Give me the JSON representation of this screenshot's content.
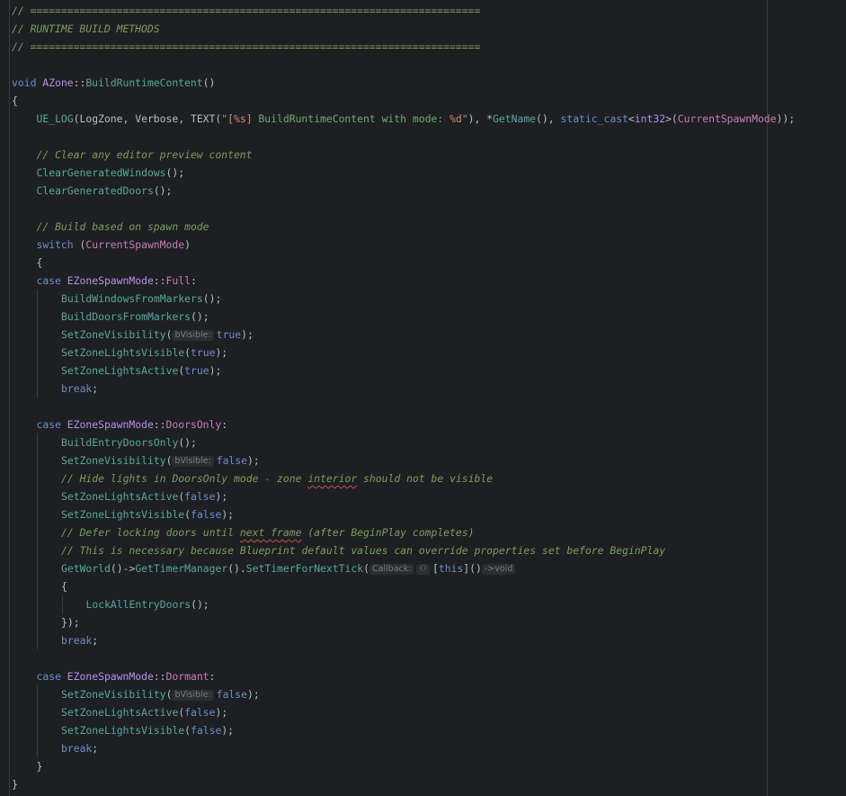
{
  "editor": {
    "language": "cpp",
    "theme_colors": {
      "background": "#1e1f22",
      "comment": "#7a9e5d",
      "keyword": "#6b8ec9",
      "type": "#b392f0",
      "function": "#56a8a0",
      "string": "#6aab73",
      "plain": "#bcbec4"
    },
    "lines": [
      {
        "indent": 0,
        "tokens": [
          {
            "t": "// =========================================================================",
            "c": "cm"
          }
        ]
      },
      {
        "indent": 0,
        "tokens": [
          {
            "t": "// RUNTIME BUILD METHODS",
            "c": "cm"
          }
        ]
      },
      {
        "indent": 0,
        "tokens": [
          {
            "t": "// =========================================================================",
            "c": "cm"
          }
        ]
      },
      {
        "indent": 0,
        "tokens": []
      },
      {
        "indent": 0,
        "tokens": [
          {
            "t": "void",
            "c": "kw"
          },
          {
            "t": " ",
            "c": "pl"
          },
          {
            "t": "AZone",
            "c": "ty"
          },
          {
            "t": "::",
            "c": "pl"
          },
          {
            "t": "BuildRuntimeContent",
            "c": "fn"
          },
          {
            "t": "()",
            "c": "pl"
          }
        ]
      },
      {
        "indent": 0,
        "tokens": [
          {
            "t": "{",
            "c": "pl"
          }
        ]
      },
      {
        "indent": 1,
        "tokens": [
          {
            "t": "UE_LOG",
            "c": "mac"
          },
          {
            "t": "(LogZone, ",
            "c": "pl"
          },
          {
            "t": "Verbose",
            "c": "pl"
          },
          {
            "t": ", ",
            "c": "pl"
          },
          {
            "t": "TEXT",
            "c": "pl"
          },
          {
            "t": "(",
            "c": "pl"
          },
          {
            "t": "\"",
            "c": "str"
          },
          {
            "t": "[%s]",
            "c": "esc"
          },
          {
            "t": " BuildRuntimeContent with mode: ",
            "c": "str"
          },
          {
            "t": "%d",
            "c": "esc"
          },
          {
            "t": "\"",
            "c": "str"
          },
          {
            "t": "), *",
            "c": "pl"
          },
          {
            "t": "GetName",
            "c": "fn"
          },
          {
            "t": "(), ",
            "c": "pl"
          },
          {
            "t": "static_cast",
            "c": "kw"
          },
          {
            "t": "<",
            "c": "pl"
          },
          {
            "t": "int32",
            "c": "ty"
          },
          {
            "t": ">(",
            "c": "pl"
          },
          {
            "t": "CurrentSpawnMode",
            "c": "cl"
          },
          {
            "t": "));",
            "c": "pl"
          }
        ]
      },
      {
        "indent": 0,
        "tokens": []
      },
      {
        "indent": 1,
        "tokens": [
          {
            "t": "// Clear any editor preview content",
            "c": "cm"
          }
        ]
      },
      {
        "indent": 1,
        "tokens": [
          {
            "t": "ClearGeneratedWindows",
            "c": "fn"
          },
          {
            "t": "();",
            "c": "pl"
          }
        ]
      },
      {
        "indent": 1,
        "tokens": [
          {
            "t": "ClearGeneratedDoors",
            "c": "fn"
          },
          {
            "t": "();",
            "c": "pl"
          }
        ]
      },
      {
        "indent": 0,
        "tokens": []
      },
      {
        "indent": 1,
        "tokens": [
          {
            "t": "// Build based on spawn mode",
            "c": "cm"
          }
        ]
      },
      {
        "indent": 1,
        "tokens": [
          {
            "t": "switch",
            "c": "kw"
          },
          {
            "t": " (",
            "c": "pl"
          },
          {
            "t": "CurrentSpawnMode",
            "c": "cl"
          },
          {
            "t": ")",
            "c": "pl"
          }
        ]
      },
      {
        "indent": 1,
        "tokens": [
          {
            "t": "{",
            "c": "pl"
          }
        ]
      },
      {
        "indent": 1,
        "tokens": [
          {
            "t": "case",
            "c": "kw"
          },
          {
            "t": " ",
            "c": "pl"
          },
          {
            "t": "EZoneSpawnMode",
            "c": "ty"
          },
          {
            "t": "::",
            "c": "pl"
          },
          {
            "t": "Full",
            "c": "cl"
          },
          {
            "t": ":",
            "c": "pl"
          }
        ]
      },
      {
        "indent": 2,
        "tokens": [
          {
            "t": "BuildWindowsFromMarkers",
            "c": "fn"
          },
          {
            "t": "();",
            "c": "pl"
          }
        ]
      },
      {
        "indent": 2,
        "tokens": [
          {
            "t": "BuildDoorsFromMarkers",
            "c": "fn"
          },
          {
            "t": "();",
            "c": "pl"
          }
        ]
      },
      {
        "indent": 2,
        "tokens": [
          {
            "t": "SetZoneVisibility",
            "c": "fn"
          },
          {
            "t": "(",
            "c": "pl"
          },
          {
            "t": "bVisible:",
            "c": "hint"
          },
          {
            "t": "true",
            "c": "kw"
          },
          {
            "t": ");",
            "c": "pl"
          }
        ]
      },
      {
        "indent": 2,
        "tokens": [
          {
            "t": "SetZoneLightsVisible",
            "c": "fn"
          },
          {
            "t": "(",
            "c": "pl"
          },
          {
            "t": "true",
            "c": "kw"
          },
          {
            "t": ");",
            "c": "pl"
          }
        ]
      },
      {
        "indent": 2,
        "tokens": [
          {
            "t": "SetZoneLightsActive",
            "c": "fn"
          },
          {
            "t": "(",
            "c": "pl"
          },
          {
            "t": "true",
            "c": "kw"
          },
          {
            "t": ");",
            "c": "pl"
          }
        ]
      },
      {
        "indent": 2,
        "tokens": [
          {
            "t": "break",
            "c": "kw"
          },
          {
            "t": ";",
            "c": "pl"
          }
        ]
      },
      {
        "indent": 0,
        "tokens": []
      },
      {
        "indent": 1,
        "tokens": [
          {
            "t": "case",
            "c": "kw"
          },
          {
            "t": " ",
            "c": "pl"
          },
          {
            "t": "EZoneSpawnMode",
            "c": "ty"
          },
          {
            "t": "::",
            "c": "pl"
          },
          {
            "t": "DoorsOnly",
            "c": "cl"
          },
          {
            "t": ":",
            "c": "pl"
          }
        ]
      },
      {
        "indent": 2,
        "tokens": [
          {
            "t": "BuildEntryDoorsOnly",
            "c": "fn"
          },
          {
            "t": "();",
            "c": "pl"
          }
        ]
      },
      {
        "indent": 2,
        "tokens": [
          {
            "t": "SetZoneVisibility",
            "c": "fn"
          },
          {
            "t": "(",
            "c": "pl"
          },
          {
            "t": "bVisible:",
            "c": "hint"
          },
          {
            "t": "false",
            "c": "kw"
          },
          {
            "t": ");",
            "c": "pl"
          }
        ]
      },
      {
        "indent": 2,
        "tokens": [
          {
            "t": "// Hide lights in DoorsOnly mode - zone ",
            "c": "cm"
          },
          {
            "t": "interior",
            "c": "cm squig"
          },
          {
            "t": " should not be visible",
            "c": "cm"
          }
        ]
      },
      {
        "indent": 2,
        "tokens": [
          {
            "t": "SetZoneLightsActive",
            "c": "fn"
          },
          {
            "t": "(",
            "c": "pl"
          },
          {
            "t": "false",
            "c": "kw"
          },
          {
            "t": ");",
            "c": "pl"
          }
        ]
      },
      {
        "indent": 2,
        "tokens": [
          {
            "t": "SetZoneLightsVisible",
            "c": "fn"
          },
          {
            "t": "(",
            "c": "pl"
          },
          {
            "t": "false",
            "c": "kw"
          },
          {
            "t": ");",
            "c": "pl"
          }
        ]
      },
      {
        "indent": 2,
        "tokens": [
          {
            "t": "// Defer locking doors until ",
            "c": "cm"
          },
          {
            "t": "next frame",
            "c": "cm squig"
          },
          {
            "t": " (after BeginPlay completes)",
            "c": "cm"
          }
        ]
      },
      {
        "indent": 2,
        "tokens": [
          {
            "t": "// This is necessary because Blueprint default values can override properties set before BeginPlay",
            "c": "cm"
          }
        ]
      },
      {
        "indent": 2,
        "tokens": [
          {
            "t": "GetWorld",
            "c": "fn"
          },
          {
            "t": "()->",
            "c": "pl"
          },
          {
            "t": "GetTimerManager",
            "c": "fn"
          },
          {
            "t": "().",
            "c": "pl"
          },
          {
            "t": "SetTimerForNextTick",
            "c": "fn"
          },
          {
            "t": "(",
            "c": "pl"
          },
          {
            "t": "Callback:",
            "c": "hint"
          },
          {
            "t": "⚇",
            "c": "hint"
          },
          {
            "t": "[",
            "c": "pl"
          },
          {
            "t": "this",
            "c": "kw"
          },
          {
            "t": "]",
            "c": "pl"
          },
          {
            "t": "()",
            "c": "pl"
          },
          {
            "t": "->void",
            "c": "hint"
          }
        ]
      },
      {
        "indent": 2,
        "tokens": [
          {
            "t": "{",
            "c": "pl"
          }
        ]
      },
      {
        "indent": 3,
        "tokens": [
          {
            "t": "LockAllEntryDoors",
            "c": "fn"
          },
          {
            "t": "();",
            "c": "pl"
          }
        ]
      },
      {
        "indent": 2,
        "tokens": [
          {
            "t": "});",
            "c": "pl"
          }
        ]
      },
      {
        "indent": 2,
        "tokens": [
          {
            "t": "break",
            "c": "kw"
          },
          {
            "t": ";",
            "c": "pl"
          }
        ]
      },
      {
        "indent": 0,
        "tokens": []
      },
      {
        "indent": 1,
        "tokens": [
          {
            "t": "case",
            "c": "kw"
          },
          {
            "t": " ",
            "c": "pl"
          },
          {
            "t": "EZoneSpawnMode",
            "c": "ty"
          },
          {
            "t": "::",
            "c": "pl"
          },
          {
            "t": "Dormant",
            "c": "cl"
          },
          {
            "t": ":",
            "c": "pl"
          }
        ]
      },
      {
        "indent": 2,
        "tokens": [
          {
            "t": "SetZoneVisibility",
            "c": "fn"
          },
          {
            "t": "(",
            "c": "pl"
          },
          {
            "t": "bVisible:",
            "c": "hint"
          },
          {
            "t": "false",
            "c": "kw"
          },
          {
            "t": ");",
            "c": "pl"
          }
        ]
      },
      {
        "indent": 2,
        "tokens": [
          {
            "t": "SetZoneLightsActive",
            "c": "fn"
          },
          {
            "t": "(",
            "c": "pl"
          },
          {
            "t": "false",
            "c": "kw"
          },
          {
            "t": ");",
            "c": "pl"
          }
        ]
      },
      {
        "indent": 2,
        "tokens": [
          {
            "t": "SetZoneLightsVisible",
            "c": "fn"
          },
          {
            "t": "(",
            "c": "pl"
          },
          {
            "t": "false",
            "c": "kw"
          },
          {
            "t": ");",
            "c": "pl"
          }
        ]
      },
      {
        "indent": 2,
        "tokens": [
          {
            "t": "break",
            "c": "kw"
          },
          {
            "t": ";",
            "c": "pl"
          }
        ]
      },
      {
        "indent": 1,
        "tokens": [
          {
            "t": "}",
            "c": "pl"
          }
        ]
      },
      {
        "indent": 0,
        "tokens": [
          {
            "t": "}",
            "c": "pl"
          }
        ]
      }
    ]
  }
}
